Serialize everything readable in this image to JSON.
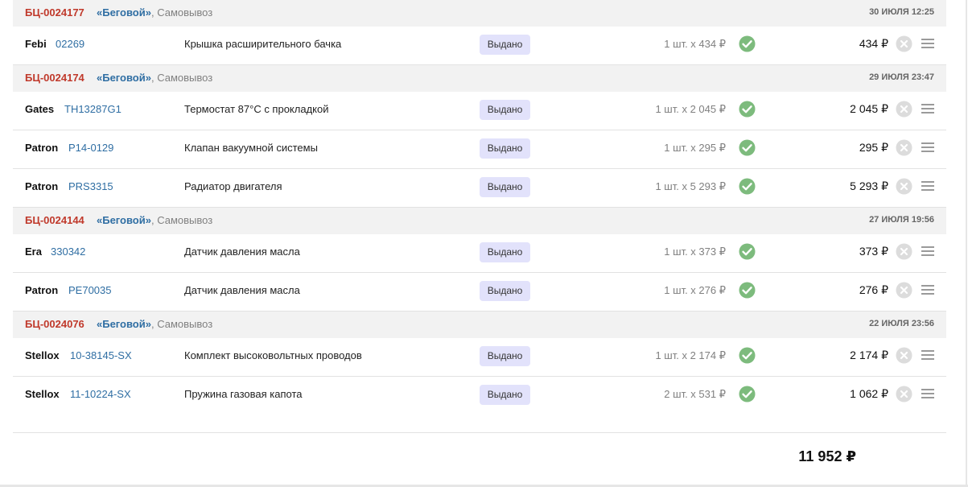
{
  "colors": {
    "order_number": "#c0392b",
    "link": "#2f6ea3",
    "status_bg": "#e2e2fb",
    "check": "#7dbb7d",
    "remove": "#dcdcdc",
    "header_bg": "#f2f2f2"
  },
  "icons": {
    "done": "check-circle-icon",
    "remove": "close-circle-icon",
    "menu": "menu-icon"
  },
  "orders": [
    {
      "number": "БЦ-0024177",
      "store": "«Беговой»",
      "delivery": ", Самовывоз",
      "date": "30 ИЮЛЯ 12:25",
      "items": [
        {
          "brand": "Febi",
          "article": "02269",
          "description": "Крышка расширительного бачка",
          "status": "Выдано",
          "qty": "1 шт. x 434 ₽",
          "total": "434 ₽"
        }
      ]
    },
    {
      "number": "БЦ-0024174",
      "store": "«Беговой»",
      "delivery": ", Самовывоз",
      "date": "29 ИЮЛЯ 23:47",
      "items": [
        {
          "brand": "Gates",
          "article": "TH13287G1",
          "description": "Термостат 87°C с прокладкой",
          "status": "Выдано",
          "qty": "1 шт. x 2 045 ₽",
          "total": "2 045 ₽"
        },
        {
          "brand": "Patron",
          "article": "P14-0129",
          "description": "Клапан вакуумной системы",
          "status": "Выдано",
          "qty": "1 шт. x 295 ₽",
          "total": "295 ₽"
        },
        {
          "brand": "Patron",
          "article": "PRS3315",
          "description": "Радиатор двигателя",
          "status": "Выдано",
          "qty": "1 шт. x 5 293 ₽",
          "total": "5 293 ₽"
        }
      ]
    },
    {
      "number": "БЦ-0024144",
      "store": "«Беговой»",
      "delivery": ", Самовывоз",
      "date": "27 ИЮЛЯ 19:56",
      "items": [
        {
          "brand": "Era",
          "article": "330342",
          "description": "Датчик давления масла",
          "status": "Выдано",
          "qty": "1 шт. x 373 ₽",
          "total": "373 ₽"
        },
        {
          "brand": "Patron",
          "article": "PE70035",
          "description": "Датчик давления масла",
          "status": "Выдано",
          "qty": "1 шт. x 276 ₽",
          "total": "276 ₽"
        }
      ]
    },
    {
      "number": "БЦ-0024076",
      "store": "«Беговой»",
      "delivery": ", Самовывоз",
      "date": "22 ИЮЛЯ 23:56",
      "items": [
        {
          "brand": "Stellox",
          "article": "10-38145-SX",
          "description": "Комплект высоковольтных проводов",
          "status": "Выдано",
          "qty": "1 шт. x 2 174 ₽",
          "total": "2 174 ₽"
        },
        {
          "brand": "Stellox",
          "article": "11-10224-SX",
          "description": "Пружина газовая капота",
          "status": "Выдано",
          "qty": "2 шт. x 531 ₽",
          "total": "1 062 ₽"
        }
      ]
    }
  ],
  "grand_total": "11 952 ₽"
}
